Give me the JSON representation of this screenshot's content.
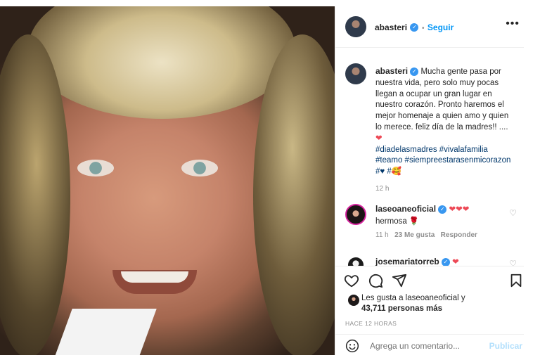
{
  "header": {
    "username": "abasteri",
    "separator": "•",
    "follow_label": "Seguir",
    "more_icon": "more-options-icon"
  },
  "caption": {
    "username": "abasteri",
    "text": "Mucha gente pasa por nuestra vida, pero solo muy pocas llegan a ocupar un gran lugar en nuestro corazón. Pronto haremos el mejor homenaje a quien amo y quien lo merece. feliz día de la madres!! ....",
    "heart": "❤",
    "hashtags": "#diadelasmadres #vivalafamilia #teamo #siempreestarasenmicorazon",
    "emojis": "#♥ #🥰",
    "age": "12 h"
  },
  "comments": [
    {
      "username": "laseoaneoficial",
      "hearts": "❤❤❤",
      "text": "hermosa 🌹",
      "age": "11 h",
      "likes": "23 Me gusta",
      "reply": "Responder"
    },
    {
      "username": "josemariatorreb",
      "hearts": "❤"
    }
  ],
  "likes": {
    "line1": "Les gusta a laseoaneoficial y",
    "line2": "43,711 personas más"
  },
  "timestamp": "HACE 12 HORAS",
  "comment_bar": {
    "placeholder": "Agrega un comentario...",
    "publish_label": "Publicar"
  },
  "colors": {
    "link": "#0095f6",
    "hashtag": "#00376b",
    "heart": "#ed4956",
    "muted": "#8e8e8e"
  }
}
